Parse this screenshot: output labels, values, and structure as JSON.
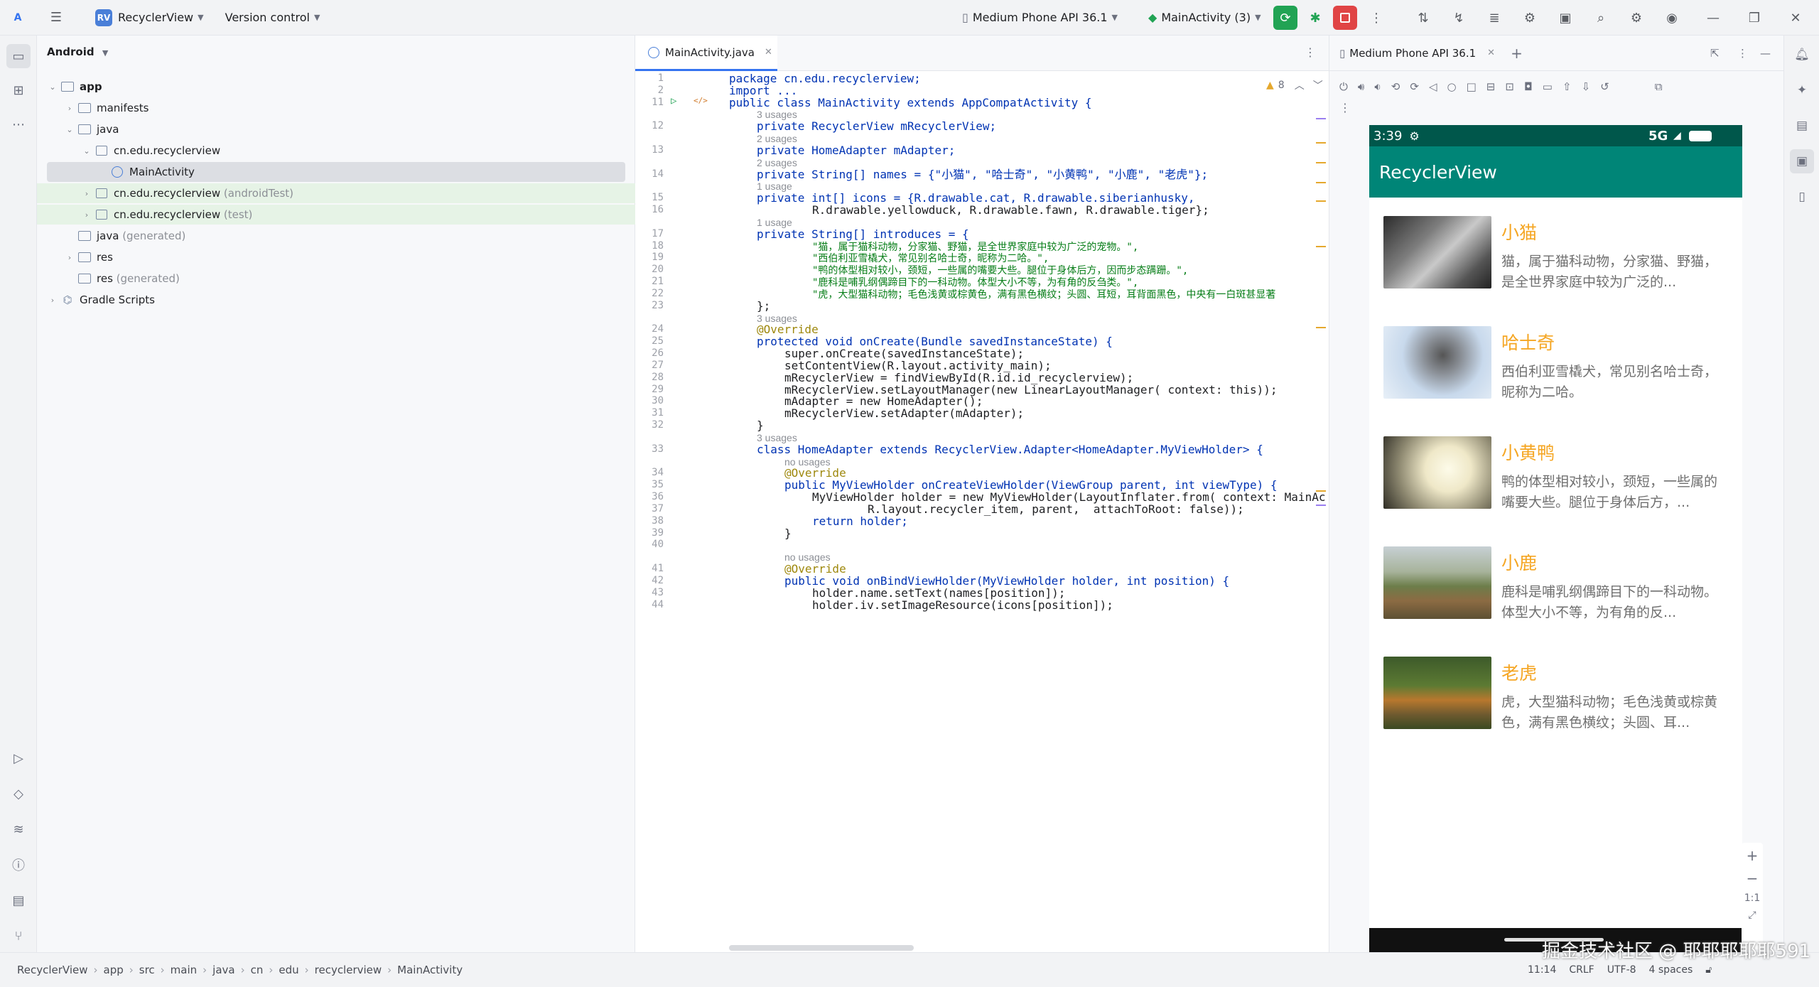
{
  "topbar": {
    "project_badge": "RV",
    "project_name": "RecyclerView",
    "vcs": "Version control",
    "device": "Medium Phone API 36.1",
    "run_config": "MainActivity (3)"
  },
  "project_panel": {
    "view_name": "Android",
    "tree": [
      {
        "label": "app",
        "suffix": ""
      },
      {
        "label": "manifests",
        "suffix": ""
      },
      {
        "label": "java",
        "suffix": ""
      },
      {
        "label": "cn.edu.recyclerview",
        "suffix": ""
      },
      {
        "label": "MainActivity",
        "suffix": ""
      },
      {
        "label": "cn.edu.recyclerview",
        "suffix": " (androidTest)"
      },
      {
        "label": "cn.edu.recyclerview",
        "suffix": " (test)"
      },
      {
        "label": "java",
        "suffix": " (generated)"
      },
      {
        "label": "res",
        "suffix": ""
      },
      {
        "label": "res",
        "suffix": " (generated)"
      },
      {
        "label": "Gradle Scripts",
        "suffix": ""
      }
    ]
  },
  "editor": {
    "tab_label": "MainActivity.java",
    "warnings": "8",
    "lines": [
      {
        "n": "1",
        "t": "package cn.edu.recyclerview;"
      },
      {
        "n": "2",
        "t": "import ..."
      },
      {
        "n": "11",
        "t": "public class MainActivity extends AppCompatActivity {"
      },
      {
        "n": "",
        "t": "3 usages"
      },
      {
        "n": "12",
        "t": "private RecyclerView mRecyclerView;"
      },
      {
        "n": "",
        "t": "2 usages"
      },
      {
        "n": "13",
        "t": "private HomeAdapter mAdapter;"
      },
      {
        "n": "",
        "t": "2 usages"
      },
      {
        "n": "14",
        "t": "private String[] names = {\"小猫\", \"哈士奇\", \"小黄鸭\", \"小鹿\", \"老虎\"};"
      },
      {
        "n": "",
        "t": "1 usage"
      },
      {
        "n": "15",
        "t": "private int[] icons = {R.drawable.cat, R.drawable.siberianhusky,"
      },
      {
        "n": "16",
        "t": "R.drawable.yellowduck, R.drawable.fawn, R.drawable.tiger};"
      },
      {
        "n": "",
        "t": "1 usage"
      },
      {
        "n": "17",
        "t": "private String[] introduces = {"
      },
      {
        "n": "18",
        "t": "\"猫，属于猫科动物，分家猫、野猫，是全世界家庭中较为广泛的宠物。\","
      },
      {
        "n": "19",
        "t": "\"西伯利亚雪橇犬，常见别名哈士奇，昵称为二哈。\","
      },
      {
        "n": "20",
        "t": "\"鸭的体型相对较小，颈短，一些属的嘴要大些。腿位于身体后方，因而步态蹒跚。\","
      },
      {
        "n": "21",
        "t": "\"鹿科是哺乳纲偶蹄目下的一科动物。体型大小不等，为有角的反刍类。\","
      },
      {
        "n": "22",
        "t": "\"虎，大型猫科动物；毛色浅黄或棕黄色，满有黑色横纹；头圆、耳短，耳背面黑色，中央有一白斑甚显著"
      },
      {
        "n": "23",
        "t": "};"
      },
      {
        "n": "",
        "t": "3 usages"
      },
      {
        "n": "24",
        "t": "@Override"
      },
      {
        "n": "25",
        "t": "protected void onCreate(Bundle savedInstanceState) {"
      },
      {
        "n": "26",
        "t": "super.onCreate(savedInstanceState);"
      },
      {
        "n": "27",
        "t": "setContentView(R.layout.activity_main);"
      },
      {
        "n": "28",
        "t": "mRecyclerView = findViewById(R.id.id_recyclerview);"
      },
      {
        "n": "29",
        "t": "mRecyclerView.setLayoutManager(new LinearLayoutManager( context: this));"
      },
      {
        "n": "30",
        "t": "mAdapter = new HomeAdapter();"
      },
      {
        "n": "31",
        "t": "mRecyclerView.setAdapter(mAdapter);"
      },
      {
        "n": "32",
        "t": "}"
      },
      {
        "n": "",
        "t": "3 usages"
      },
      {
        "n": "33",
        "t": "class HomeAdapter extends RecyclerView.Adapter<HomeAdapter.MyViewHolder> {"
      },
      {
        "n": "",
        "t": "no usages"
      },
      {
        "n": "34",
        "t": "@Override"
      },
      {
        "n": "35",
        "t": "public MyViewHolder onCreateViewHolder(ViewGroup parent, int viewType) {"
      },
      {
        "n": "36",
        "t": "MyViewHolder holder = new MyViewHolder(LayoutInflater.from( context: MainAc"
      },
      {
        "n": "37",
        "t": "R.layout.recycler_item, parent,  attachToRoot: false));"
      },
      {
        "n": "38",
        "t": "return holder;"
      },
      {
        "n": "39",
        "t": "}"
      },
      {
        "n": "40",
        "t": ""
      },
      {
        "n": "",
        "t": "no usages"
      },
      {
        "n": "41",
        "t": "@Override"
      },
      {
        "n": "42",
        "t": "public void onBindViewHolder(MyViewHolder holder, int position) {"
      },
      {
        "n": "43",
        "t": "holder.name.setText(names[position]);"
      },
      {
        "n": "44",
        "t": "holder.iv.setImageResource(icons[position]);"
      }
    ]
  },
  "device_panel": {
    "tab_label": "Medium Phone API 36.1",
    "status_time": "3:39",
    "status_net": "5G",
    "app_title": "RecyclerView",
    "items": [
      {
        "name": "小猫",
        "desc": "猫，属于猫科动物，分家猫、野猫，是全世界家庭中较为广泛的..."
      },
      {
        "name": "哈士奇",
        "desc": "西伯利亚雪橇犬，常见别名哈士奇，昵称为二哈。"
      },
      {
        "name": "小黄鸭",
        "desc": "鸭的体型相对较小，颈短，一些属的嘴要大些。腿位于身体后方，..."
      },
      {
        "name": "小鹿",
        "desc": "鹿科是哺乳纲偶蹄目下的一科动物。体型大小不等，为有角的反..."
      },
      {
        "name": "老虎",
        "desc": "虎，大型猫科动物；毛色浅黄或棕黄色，满有黑色横纹；头圆、耳..."
      }
    ],
    "zoom_label": "1:1"
  },
  "statusbar": {
    "breadcrumbs": [
      "RecyclerView",
      "app",
      "src",
      "main",
      "java",
      "cn",
      "edu",
      "recyclerview",
      "MainActivity"
    ],
    "position": "11:14",
    "line_sep": "CRLF",
    "encoding": "UTF-8",
    "indent": "4 spaces"
  },
  "watermark": "掘金技术社区 @ 耶耶耶耶耶591"
}
